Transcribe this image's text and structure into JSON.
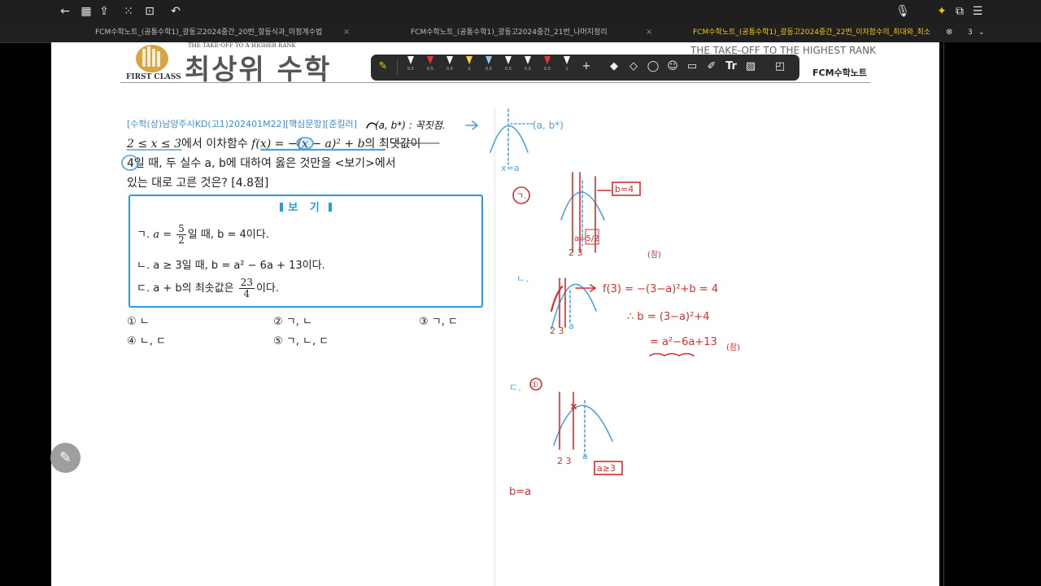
{
  "topbar": {
    "left_icons": [
      "back-arrow-icon",
      "grid-icon",
      "export-icon",
      "apps-icon",
      "crop-icon",
      "undo-icon"
    ],
    "right_icons": [
      "mic-icon",
      "sparkle-icon",
      "window-icon",
      "menu-icon"
    ]
  },
  "tabs": [
    {
      "label": "FCM수학노트_(공통수학1)_광동고2024중간_20번_항등식과_미정계수법",
      "active": false
    },
    {
      "label": "FCM수학노트_(공통수학1)_광동고2024중간_21번_나머지정리",
      "active": false
    },
    {
      "label": "FCM수학노트_(공통수학1)_광동고2024중간_22번_이차함수의_최대와_최소",
      "active": true
    }
  ],
  "page_count": "3",
  "header": {
    "logo_caption": "FIRST CLASS",
    "tagline": "THE TAKE-OFF TO A HIGHER RANK",
    "title": "최상위 수학",
    "slogan": "THE TAKE-OFF TO THE HIGHEST RANK",
    "brand": "FCM수학노트"
  },
  "toolbar": {
    "pens": [
      {
        "color": "#ffffff",
        "size": "0.5"
      },
      {
        "color": "#e53935",
        "size": "0.5"
      },
      {
        "color": "#ffffff",
        "size": "0.5"
      },
      {
        "color": "#fdd835",
        "size": "2"
      },
      {
        "color": "#90caf9",
        "size": "0.5"
      },
      {
        "color": "#ffffff",
        "size": "0.5"
      },
      {
        "color": "#ffffff",
        "size": "0.5"
      },
      {
        "color": "#e53935",
        "size": "0.5"
      },
      {
        "color": "#ffffff",
        "size": "1"
      }
    ],
    "tool_icons": [
      "plus-icon",
      "eraser-icon",
      "shape-icon",
      "lasso-icon",
      "sticker-icon",
      "comment-icon",
      "laser-icon",
      "text-icon",
      "image-icon",
      "note-icon"
    ],
    "text_tool_label": "Tr"
  },
  "question": {
    "source": "[수학(상)남양주시KD(고1)202401M22][핵심문항][준킬러]",
    "line1_a": "2 ≤ x ≤ 3",
    "line1_b": "에서 이차함수 ",
    "line1_c": "f(x) = −(x − a)² + b",
    "line1_d": "의 최댓값이",
    "line2": "4일 때, 두 실수 a, b에 대하여 옳은 것만을 <보기>에서",
    "line3": "있는 대로 고른 것은? [4.8점]"
  },
  "bogi": {
    "title": "보 기",
    "s1_pre": "ㄱ. ",
    "s1_a": "a =",
    "s1_num": "5",
    "s1_den": "2",
    "s1_post": "일 때, b = 4이다.",
    "s2": "ㄴ. a ≥ 3일 때, b = a² − 6a + 13이다.",
    "s3_pre": "ㄷ. a + b의 최솟값은",
    "s3_num": "23",
    "s3_den": "4",
    "s3_post": "이다."
  },
  "choices": [
    "① ㄴ",
    "② ㄱ, ㄴ",
    "③ ㄱ, ㄷ",
    "④ ㄴ, ㄷ",
    "⑤ ㄱ, ㄴ, ㄷ"
  ],
  "handwriting": {
    "top_note": "(a, b*) : 꼭짓점.",
    "vertex_label": "(a, b*)",
    "axis_label": "x=a",
    "case1": "ㄱ.",
    "case1_box": "b=4",
    "case1_axis": "a=5/2",
    "case1_ticks": "2   3",
    "case1_mark": "(참)",
    "case2": "ㄴ.",
    "case2_eq1": "f(3) = −(3−a)²+b = 4",
    "case2_eq2": "∴ b = (3−a)²+4",
    "case2_eq3": "= a²−6a+13",
    "case2_mark": "(참)",
    "case2_ticks": "2 3",
    "case2_a": "a",
    "case3": "ㄷ.",
    "case3_num": "①",
    "case3_ticks": "2   3",
    "case3_a": "a",
    "case3_box": "a≥3",
    "case3_eq": "b=a"
  },
  "colors": {
    "accent_blue": "#2b9bd6",
    "pen_red": "#d32f2f",
    "highlight_blue": "#4aa3df",
    "tab_active": "#f5c518"
  }
}
